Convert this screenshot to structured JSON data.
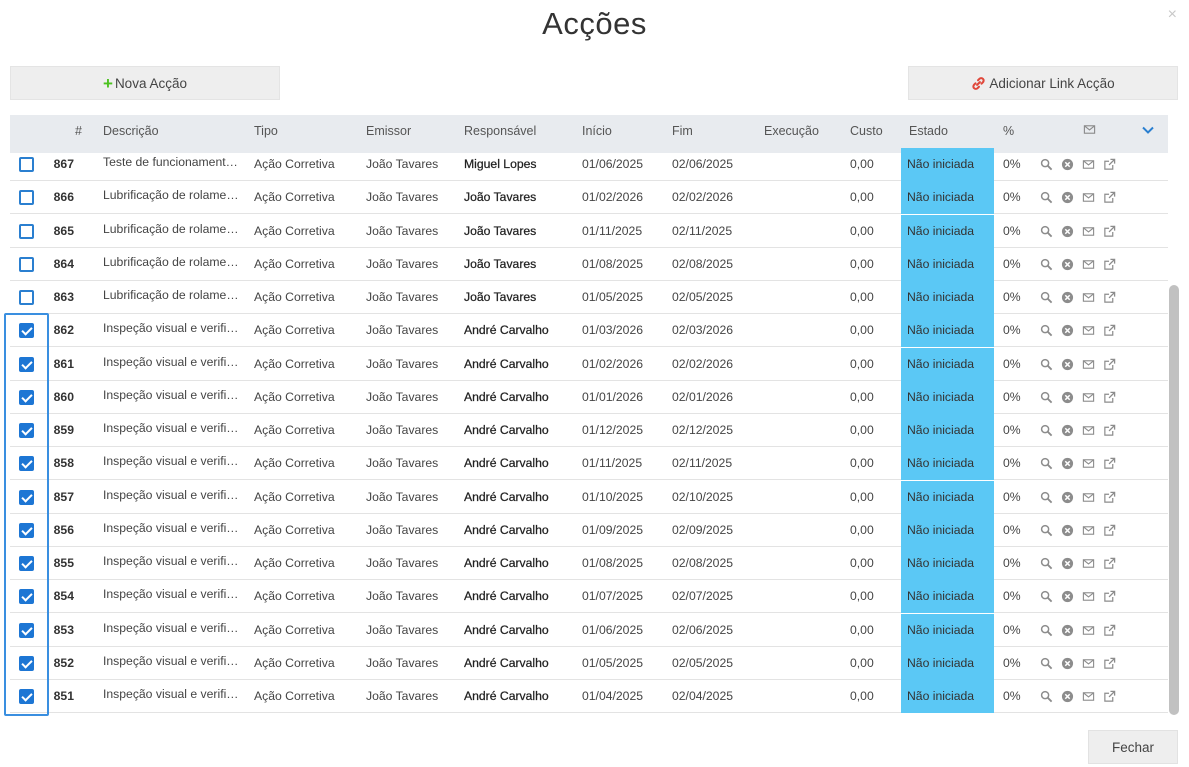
{
  "dialog": {
    "title": "Acções",
    "close_glyph": "×",
    "new_action_label": "Nova Acção",
    "add_link_label": "Adicionar Link Acção",
    "close_label": "Fechar",
    "accent_color": "#1d76d4",
    "status_color": "#5bc8f5",
    "plus_color": "#4cc21f",
    "link_icon_color": "#e0473a"
  },
  "table": {
    "columns": {
      "num": "#",
      "descricao": "Descrição",
      "tipo": "Tipo",
      "emissor": "Emissor",
      "responsavel": "Responsável",
      "inicio": "Início",
      "fim": "Fim",
      "execucao": "Execução",
      "custo": "Custo",
      "estado": "Estado",
      "percent": "%"
    },
    "header_icons": [
      "envelope-icon",
      "chevron-down-icon"
    ],
    "row_icons": [
      "search-icon",
      "cancel-circle-icon",
      "envelope-icon",
      "external-link-icon"
    ],
    "rows": [
      {
        "checked": false,
        "num": "867",
        "descricao": "Teste de funcionamento d...",
        "tipo": "Ação Corretiva",
        "emissor": "João Tavares",
        "responsavel": "Miguel Lopes",
        "inicio": "01/06/2025",
        "fim": "02/06/2025",
        "execucao": "",
        "custo": "0,00",
        "estado": "Não iniciada",
        "percent": "0%"
      },
      {
        "checked": false,
        "num": "866",
        "descricao": "Lubrificação de rolament...",
        "tipo": "Ação Corretiva",
        "emissor": "João Tavares",
        "responsavel": "João Tavares",
        "inicio": "01/02/2026",
        "fim": "02/02/2026",
        "execucao": "",
        "custo": "0,00",
        "estado": "Não iniciada",
        "percent": "0%"
      },
      {
        "checked": false,
        "num": "865",
        "descricao": "Lubrificação de rolament...",
        "tipo": "Ação Corretiva",
        "emissor": "João Tavares",
        "responsavel": "João Tavares",
        "inicio": "01/11/2025",
        "fim": "02/11/2025",
        "execucao": "",
        "custo": "0,00",
        "estado": "Não iniciada",
        "percent": "0%"
      },
      {
        "checked": false,
        "num": "864",
        "descricao": "Lubrificação de rolament...",
        "tipo": "Ação Corretiva",
        "emissor": "João Tavares",
        "responsavel": "João Tavares",
        "inicio": "01/08/2025",
        "fim": "02/08/2025",
        "execucao": "",
        "custo": "0,00",
        "estado": "Não iniciada",
        "percent": "0%"
      },
      {
        "checked": false,
        "num": "863",
        "descricao": "Lubrificação de rolament...",
        "tipo": "Ação Corretiva",
        "emissor": "João Tavares",
        "responsavel": "João Tavares",
        "inicio": "01/05/2025",
        "fim": "02/05/2025",
        "execucao": "",
        "custo": "0,00",
        "estado": "Não iniciada",
        "percent": "0%"
      },
      {
        "checked": true,
        "num": "862",
        "descricao": "Inspeção visual e verificaç...",
        "tipo": "Ação Corretiva",
        "emissor": "João Tavares",
        "responsavel": "André Carvalho",
        "inicio": "01/03/2026",
        "fim": "02/03/2026",
        "execucao": "",
        "custo": "0,00",
        "estado": "Não iniciada",
        "percent": "0%"
      },
      {
        "checked": true,
        "num": "861",
        "descricao": "Inspeção visual e verificaç...",
        "tipo": "Ação Corretiva",
        "emissor": "João Tavares",
        "responsavel": "André Carvalho",
        "inicio": "01/02/2026",
        "fim": "02/02/2026",
        "execucao": "",
        "custo": "0,00",
        "estado": "Não iniciada",
        "percent": "0%"
      },
      {
        "checked": true,
        "num": "860",
        "descricao": "Inspeção visual e verificaç...",
        "tipo": "Ação Corretiva",
        "emissor": "João Tavares",
        "responsavel": "André Carvalho",
        "inicio": "01/01/2026",
        "fim": "02/01/2026",
        "execucao": "",
        "custo": "0,00",
        "estado": "Não iniciada",
        "percent": "0%"
      },
      {
        "checked": true,
        "num": "859",
        "descricao": "Inspeção visual e verificaç...",
        "tipo": "Ação Corretiva",
        "emissor": "João Tavares",
        "responsavel": "André Carvalho",
        "inicio": "01/12/2025",
        "fim": "02/12/2025",
        "execucao": "",
        "custo": "0,00",
        "estado": "Não iniciada",
        "percent": "0%"
      },
      {
        "checked": true,
        "num": "858",
        "descricao": "Inspeção visual e verificaç...",
        "tipo": "Ação Corretiva",
        "emissor": "João Tavares",
        "responsavel": "André Carvalho",
        "inicio": "01/11/2025",
        "fim": "02/11/2025",
        "execucao": "",
        "custo": "0,00",
        "estado": "Não iniciada",
        "percent": "0%"
      },
      {
        "checked": true,
        "num": "857",
        "descricao": "Inspeção visual e verificaç...",
        "tipo": "Ação Corretiva",
        "emissor": "João Tavares",
        "responsavel": "André Carvalho",
        "inicio": "01/10/2025",
        "fim": "02/10/2025",
        "execucao": "",
        "custo": "0,00",
        "estado": "Não iniciada",
        "percent": "0%"
      },
      {
        "checked": true,
        "num": "856",
        "descricao": "Inspeção visual e verificaç...",
        "tipo": "Ação Corretiva",
        "emissor": "João Tavares",
        "responsavel": "André Carvalho",
        "inicio": "01/09/2025",
        "fim": "02/09/2025",
        "execucao": "",
        "custo": "0,00",
        "estado": "Não iniciada",
        "percent": "0%"
      },
      {
        "checked": true,
        "num": "855",
        "descricao": "Inspeção visual e verificaç...",
        "tipo": "Ação Corretiva",
        "emissor": "João Tavares",
        "responsavel": "André Carvalho",
        "inicio": "01/08/2025",
        "fim": "02/08/2025",
        "execucao": "",
        "custo": "0,00",
        "estado": "Não iniciada",
        "percent": "0%"
      },
      {
        "checked": true,
        "num": "854",
        "descricao": "Inspeção visual e verificaç...",
        "tipo": "Ação Corretiva",
        "emissor": "João Tavares",
        "responsavel": "André Carvalho",
        "inicio": "01/07/2025",
        "fim": "02/07/2025",
        "execucao": "",
        "custo": "0,00",
        "estado": "Não iniciada",
        "percent": "0%"
      },
      {
        "checked": true,
        "num": "853",
        "descricao": "Inspeção visual e verificaç...",
        "tipo": "Ação Corretiva",
        "emissor": "João Tavares",
        "responsavel": "André Carvalho",
        "inicio": "01/06/2025",
        "fim": "02/06/2025",
        "execucao": "",
        "custo": "0,00",
        "estado": "Não iniciada",
        "percent": "0%"
      },
      {
        "checked": true,
        "num": "852",
        "descricao": "Inspeção visual e verificaç...",
        "tipo": "Ação Corretiva",
        "emissor": "João Tavares",
        "responsavel": "André Carvalho",
        "inicio": "01/05/2025",
        "fim": "02/05/2025",
        "execucao": "",
        "custo": "0,00",
        "estado": "Não iniciada",
        "percent": "0%"
      },
      {
        "checked": true,
        "num": "851",
        "descricao": "Inspeção visual e verificaç...",
        "tipo": "Ação Corretiva",
        "emissor": "João Tavares",
        "responsavel": "André Carvalho",
        "inicio": "01/04/2025",
        "fim": "02/04/2025",
        "execucao": "",
        "custo": "0,00",
        "estado": "Não iniciada",
        "percent": "0%"
      }
    ]
  }
}
